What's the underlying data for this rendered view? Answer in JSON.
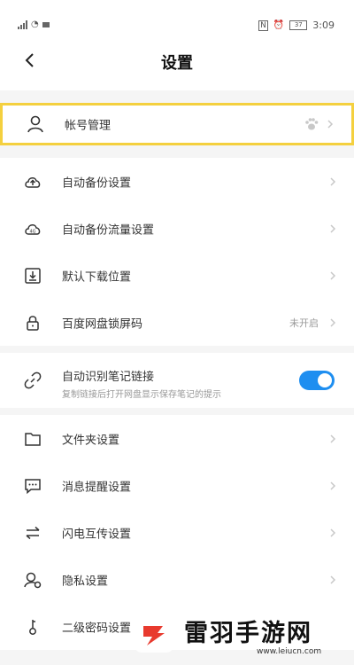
{
  "statusbar": {
    "time": "3:09",
    "battery_pct": "37"
  },
  "header": {
    "title": "设置"
  },
  "items": [
    {
      "label": "帐号管理"
    },
    {
      "label": "自动备份设置"
    },
    {
      "label": "自动备份流量设置"
    },
    {
      "label": "默认下载位置"
    },
    {
      "label": "百度网盘锁屏码",
      "value": "未开启"
    },
    {
      "label": "自动识别笔记链接",
      "sub": "复制链接后打开网盘显示保存笔记的提示",
      "toggle_on": true
    },
    {
      "label": "文件夹设置"
    },
    {
      "label": "消息提醒设置"
    },
    {
      "label": "闪电互传设置"
    },
    {
      "label": "隐私设置"
    },
    {
      "label": "二级密码设置"
    }
  ],
  "watermark": {
    "text": "雷羽手游网",
    "url": "www.leiucn.com"
  },
  "colors": {
    "accent": "#1e8ef0",
    "highlight": "#f4d03f",
    "watermark_red": "#e83a2e"
  }
}
